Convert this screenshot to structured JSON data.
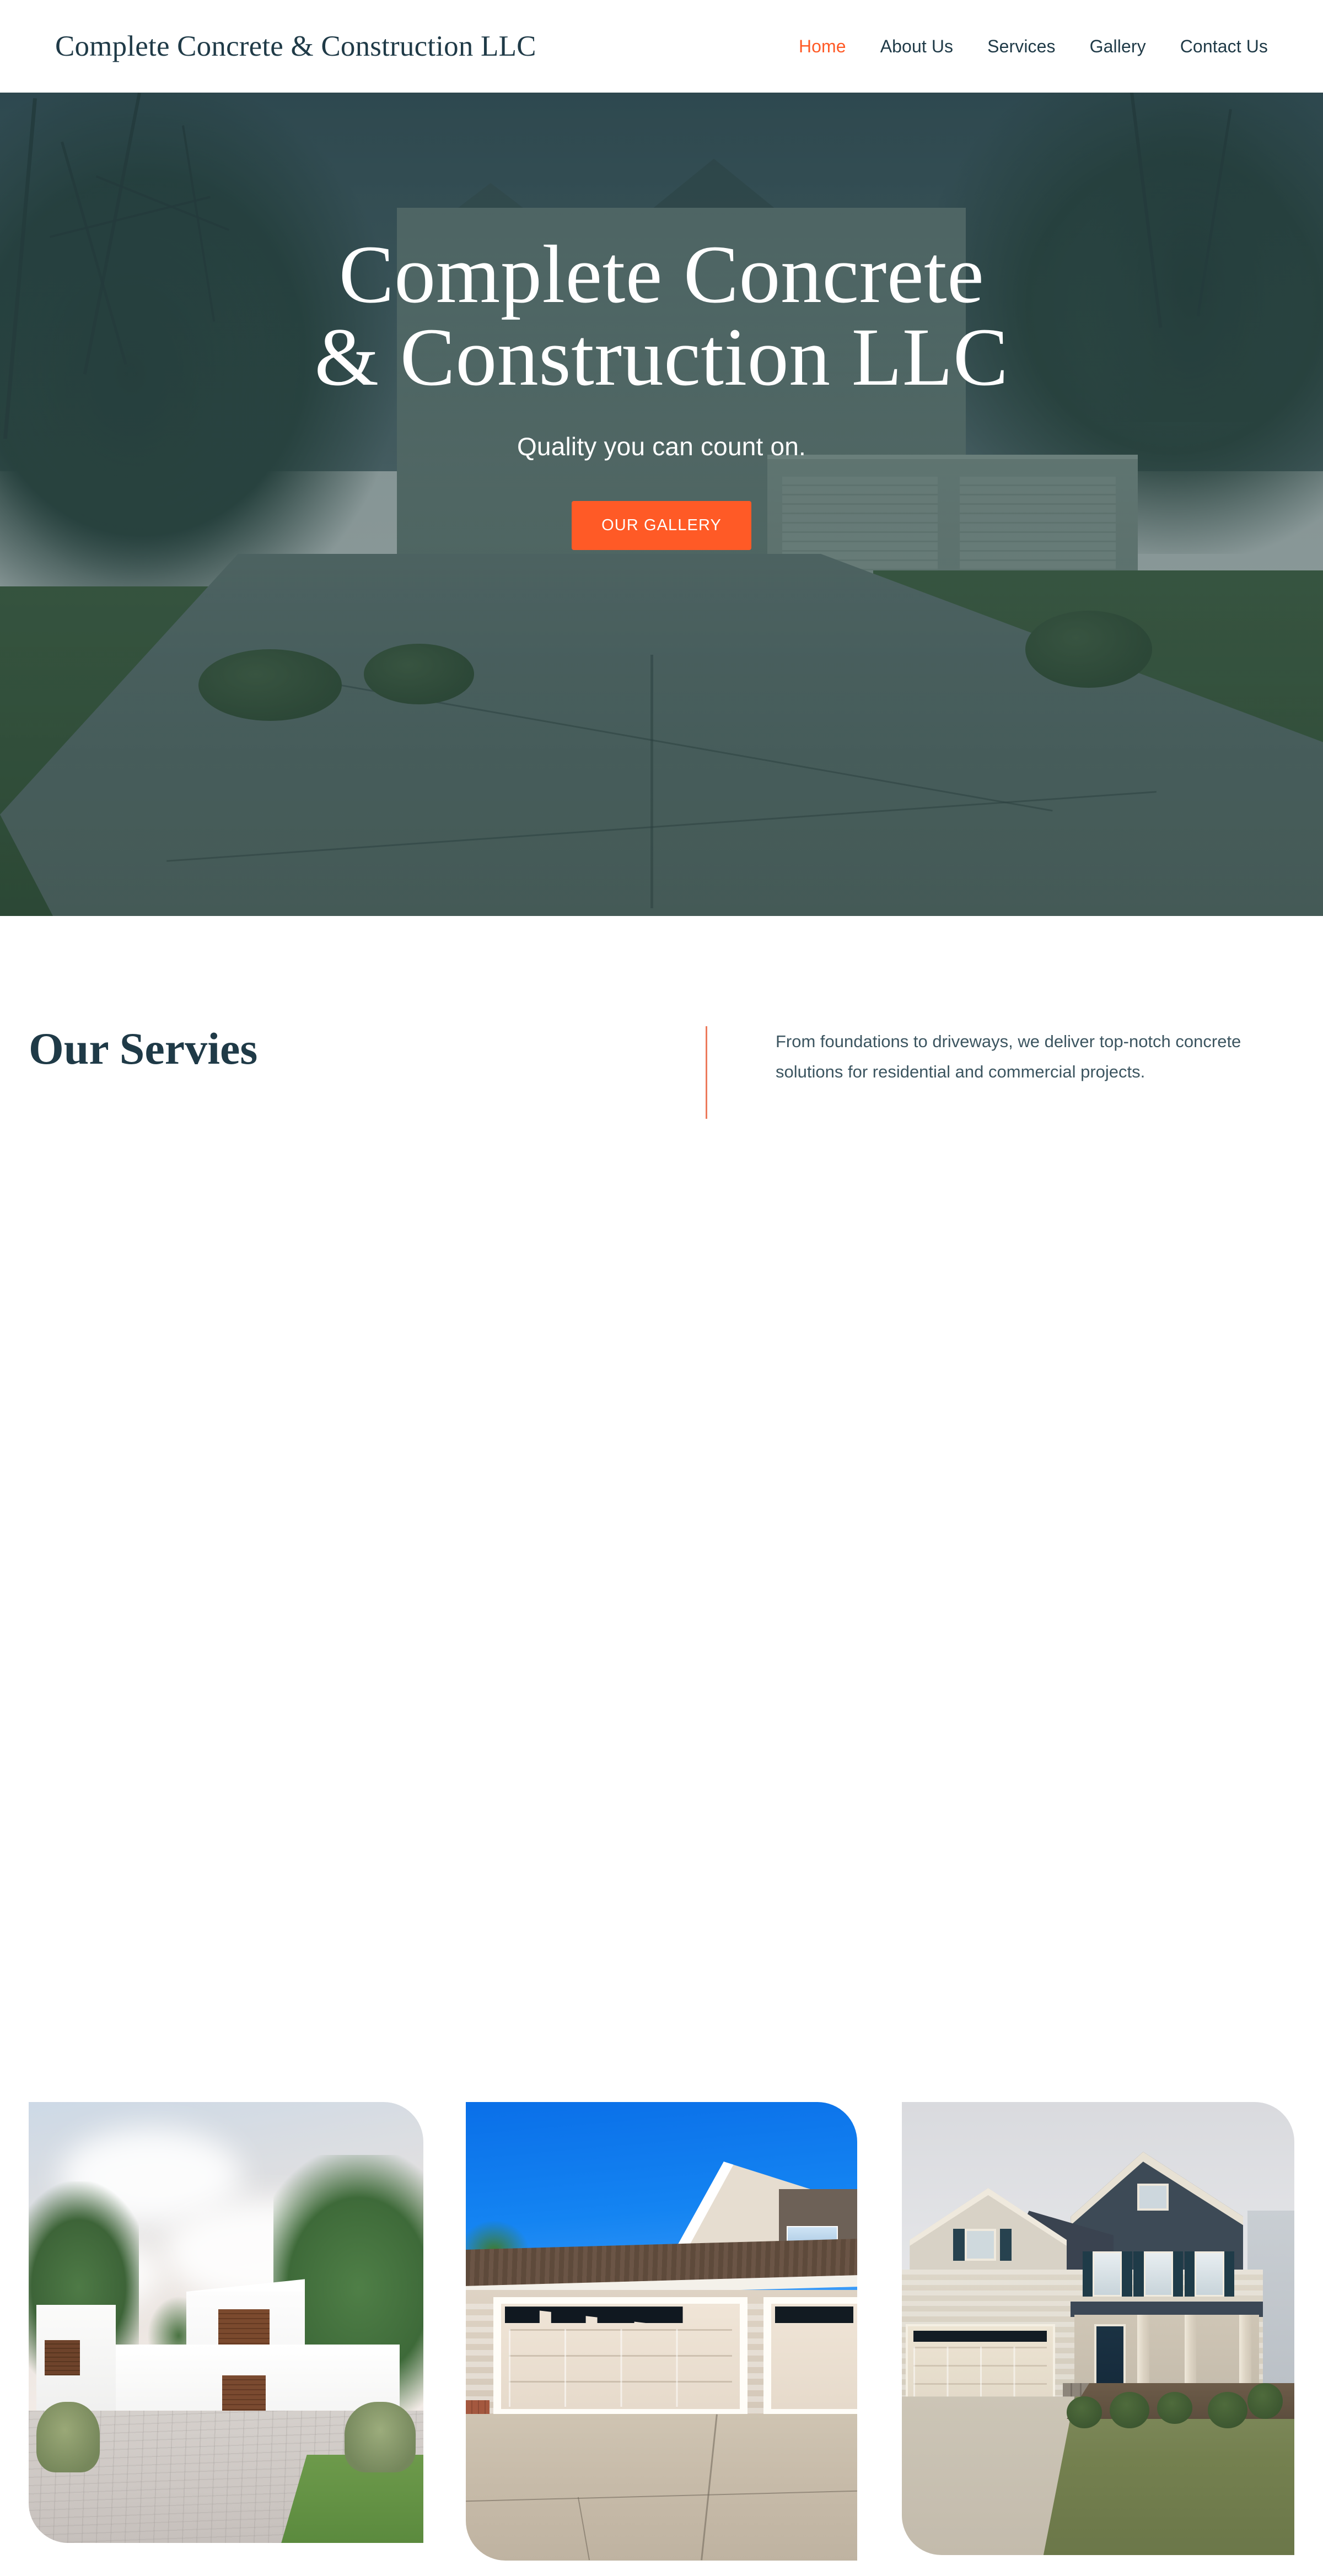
{
  "header": {
    "brand": "Complete Concrete & Construction LLC",
    "nav": [
      {
        "label": "Home",
        "active": true
      },
      {
        "label": "About Us",
        "active": false
      },
      {
        "label": "Services",
        "active": false
      },
      {
        "label": "Gallery",
        "active": false
      },
      {
        "label": "Contact Us",
        "active": false
      }
    ]
  },
  "hero": {
    "title_line_1": "Complete Concrete",
    "title_line_2": "& Construction LLC",
    "subtitle": "Quality you can count on.",
    "cta_label": "OUR GALLERY"
  },
  "services": {
    "heading": "Our Servies",
    "description": "From foundations to driveways, we deliver top-notch concrete solutions for residential and commercial projects.",
    "cards": [
      {
        "alt": "modern-white-house-with-paver-driveway"
      },
      {
        "alt": "beige-garage-doors-with-concrete-driveway"
      },
      {
        "alt": "craftsman-home-with-concrete-driveway"
      }
    ]
  },
  "colors": {
    "accent_orange": "#FF5A26",
    "rule_coral": "#ED7A5C",
    "heading_teal": "#1F3A47",
    "body_text": "#3C5560",
    "page_background": "#FFFFFF"
  }
}
